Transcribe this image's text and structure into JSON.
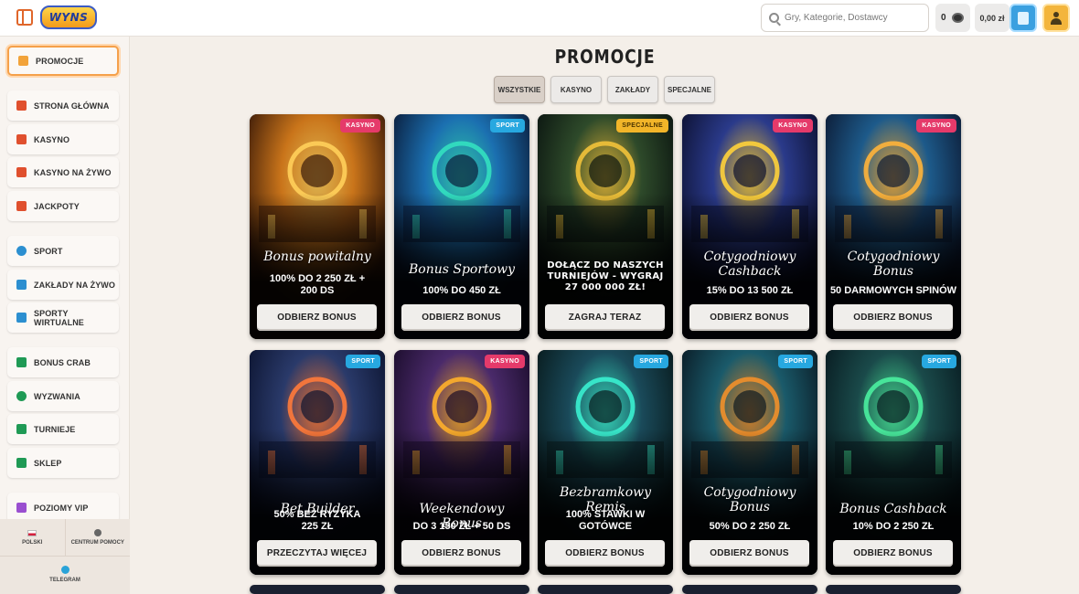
{
  "header": {
    "logo_text": "WYNS",
    "search_placeholder": "Gry, Kategorie, Dostawcy",
    "coins": "0",
    "balance": "0,00 zł"
  },
  "sidebar": {
    "items": [
      {
        "label": "PROMOCJE",
        "icon": "gift-icon",
        "color": "#f2a33a"
      },
      {
        "label": "STRONA GŁÓWNA",
        "icon": "home-icon",
        "color": "#e0502e"
      },
      {
        "label": "KASYNO",
        "icon": "slot-icon",
        "color": "#e0502e"
      },
      {
        "label": "KASYNO NA ŻYWO",
        "icon": "live-casino-icon",
        "color": "#e0502e"
      },
      {
        "label": "JACKPOTY",
        "icon": "jackpot-icon",
        "color": "#e0502e"
      },
      {
        "label": "SPORT",
        "icon": "ball-icon",
        "color": "#2c8fd0"
      },
      {
        "label": "ZAKŁADY NA ŻYWO",
        "icon": "live-bet-icon",
        "color": "#2c8fd0"
      },
      {
        "label": "SPORTY WIRTUALNE",
        "icon": "monitor-icon",
        "color": "#2c8fd0"
      },
      {
        "label": "BONUS CRAB",
        "icon": "crab-icon",
        "color": "#1f9a55"
      },
      {
        "label": "WYZWANIA",
        "icon": "target-icon",
        "color": "#1f9a55"
      },
      {
        "label": "TURNIEJE",
        "icon": "trophy-icon",
        "color": "#1f9a55"
      },
      {
        "label": "SKLEP",
        "icon": "shop-icon",
        "color": "#1f9a55"
      },
      {
        "label": "POZIOMY VIP",
        "icon": "diamond-icon",
        "color": "#9a4fd0"
      }
    ],
    "footer": {
      "language": "POLSKI",
      "help": "CENTRUM POMOCY",
      "telegram": "TELEGRAM"
    }
  },
  "main": {
    "title": "PROMOCJE",
    "filters": [
      "WSZYSTKIE",
      "KASYNO",
      "ZAKŁADY",
      "SPECJALNE"
    ],
    "cards": [
      {
        "tag": "KASYNO",
        "tag_type": "kasyno",
        "title": "Bonus powitalny",
        "subtitle": "100% DO 2 250 ZŁ + 200 DS",
        "button": "ODBIERZ BONUS",
        "theme": [
          "#3b1a08",
          "#c9741a",
          "#ffcf5a"
        ]
      },
      {
        "tag": "SPORT",
        "tag_type": "sport",
        "title": "Bonus Sportowy",
        "subtitle": "100% DO 450 ZŁ",
        "button": "ODBIERZ BONUS",
        "theme": [
          "#0a1c3a",
          "#1b6fb0",
          "#33e0c0"
        ]
      },
      {
        "tag": "SPECJALNE",
        "tag_type": "specjalne",
        "title": "DOŁĄCZ DO NASZYCH TURNIEJÓW - WYGRAJ 27 000 000 ZŁ!",
        "subtitle": "",
        "button": "ZAGRAJ TERAZ",
        "theme": [
          "#0a1410",
          "#2e4a2a",
          "#f2c23a"
        ]
      },
      {
        "tag": "KASYNO",
        "tag_type": "kasyno",
        "title": "Cotygodniowy Cashback",
        "subtitle": "15% DO 13 500 ZŁ",
        "button": "ODBIERZ BONUS",
        "theme": [
          "#0c1030",
          "#2a3a8a",
          "#ffd23a"
        ]
      },
      {
        "tag": "KASYNO",
        "tag_type": "kasyno",
        "title": "Cotygodniowy Bonus",
        "subtitle": "50 DARMOWYCH SPINÓW",
        "button": "ODBIERZ BONUS",
        "theme": [
          "#0c1a34",
          "#1d5a8a",
          "#ffb43a"
        ]
      },
      {
        "tag": "SPORT",
        "tag_type": "sport",
        "title": "Bet Builder",
        "subtitle": "50% BEZ RYZYKA 225 ZŁ",
        "button": "PRZECZYTAJ WIĘCEJ",
        "theme": [
          "#0c1430",
          "#2a3a6a",
          "#ff7a3a"
        ]
      },
      {
        "tag": "KASYNO",
        "tag_type": "kasyno",
        "title": "Weekendowy Bonus",
        "subtitle": "DO 3 150 ZŁ + 50 DS",
        "button": "ODBIERZ BONUS",
        "theme": [
          "#1a0c2a",
          "#4a2a6a",
          "#ffb02a"
        ]
      },
      {
        "tag": "SPORT",
        "tag_type": "sport",
        "title": "Bezbramkowy Remis",
        "subtitle": "100% STAWKI W GOTÓWCE",
        "button": "ODBIERZ BONUS",
        "theme": [
          "#081a1c",
          "#1a4a5a",
          "#3af0d0"
        ]
      },
      {
        "tag": "SPORT",
        "tag_type": "sport",
        "title": "Cotygodniowy Bonus",
        "subtitle": "50% DO 2 250 ZŁ",
        "button": "ODBIERZ BONUS",
        "theme": [
          "#0a1a24",
          "#1a5a6a",
          "#f2902a"
        ]
      },
      {
        "tag": "SPORT",
        "tag_type": "sport",
        "title": "Bonus Cashback",
        "subtitle": "10% DO 2 250 ZŁ",
        "button": "ODBIERZ BONUS",
        "theme": [
          "#081a20",
          "#1a4a4a",
          "#4af0a0"
        ]
      }
    ]
  }
}
